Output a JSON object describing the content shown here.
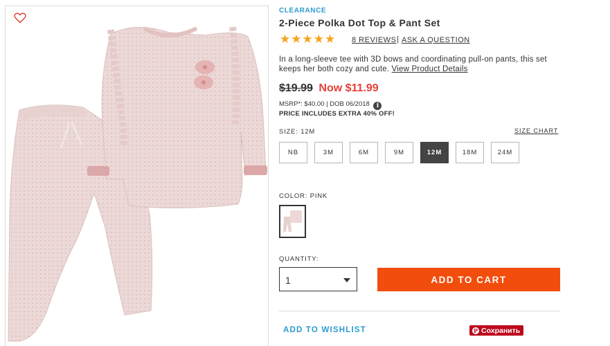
{
  "product": {
    "badge": "CLEARANCE",
    "title": "2-Piece Polka Dot Top & Pant Set",
    "rating_stars": 5,
    "reviews_link": "8 REVIEWS",
    "separator": "|",
    "question_link": "ASK A QUESTION",
    "description": "In a long-sleeve tee with 3D bows and coordinating pull-on pants, this set keeps her both cozy and cute.",
    "details_link": "View Product Details",
    "price_old": "$19.99",
    "price_now": "Now $11.99",
    "msrp": "MSRP*: $40.00 | DOB 06/2018",
    "info_icon_glyph": "i",
    "promo": "PRICE INCLUDES EXTRA 40% OFF!"
  },
  "size": {
    "label": "SIZE:",
    "selected": "12M",
    "chart_link": "SIZE CHART",
    "options": [
      "NB",
      "3M",
      "6M",
      "9M",
      "12M",
      "18M",
      "24M"
    ]
  },
  "color": {
    "label": "COLOR:",
    "selected": "PINK"
  },
  "quantity": {
    "label": "QUANTITY:",
    "value": "1"
  },
  "actions": {
    "add_to_cart": "ADD TO CART",
    "add_to_wishlist": "ADD TO WISHLIST",
    "pin_save": "Сохранить",
    "pin_glyph": "P"
  },
  "colors": {
    "accent_blue": "#2b9bcf",
    "sale_red": "#e5403a",
    "cart_orange": "#f24d0c",
    "star_gold": "#f7a21b",
    "pinterest_red": "#bd081c",
    "garment_pink": "#ecd8d6"
  },
  "icons": [
    "heart-outline-icon",
    "star-icon",
    "info-icon",
    "caret-down-icon",
    "pinterest-icon"
  ]
}
